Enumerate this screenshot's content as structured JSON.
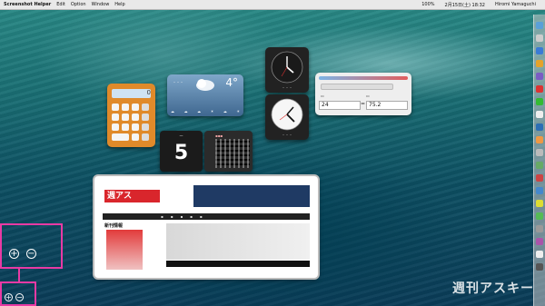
{
  "menubar": {
    "app": "Screenshot Helper",
    "items": [
      "Edit",
      "Option",
      "Window",
      "Help"
    ],
    "battery": "100%",
    "date": "2月15日(土) 18:32",
    "user": "Hiromi Yamaguchi"
  },
  "calculator": {
    "display": "0"
  },
  "weather": {
    "temp": "4°"
  },
  "converter": {
    "value_left": "24",
    "operator": "=",
    "value_right": "75.2"
  },
  "flip_calendar": {
    "number": "5"
  },
  "webclip": {
    "section": "新刊情報"
  },
  "zoom": {
    "plus": "+",
    "minus": "−"
  }
}
